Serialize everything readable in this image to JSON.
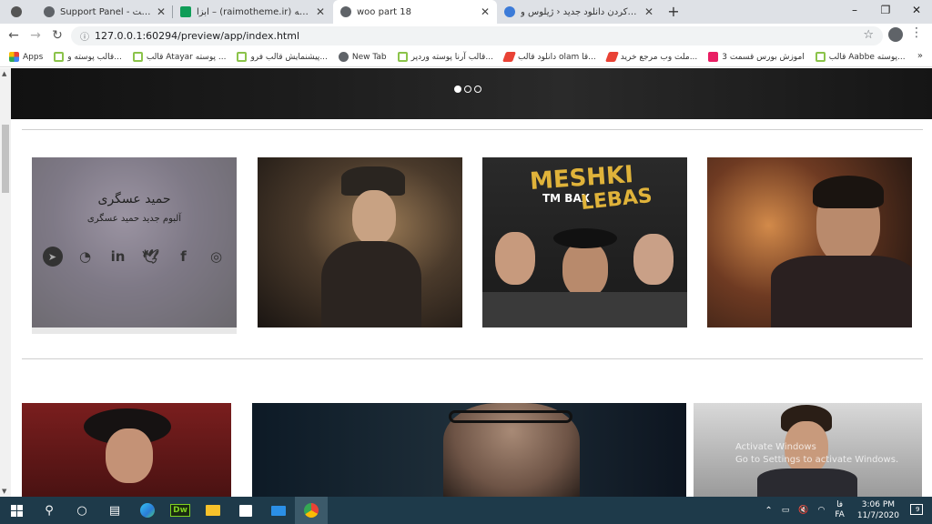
{
  "browser": {
    "tabs": [
      {
        "title": "Support Panel - مشاهده تیکت",
        "favicon": "globe-icon",
        "active": false
      },
      {
        "title": "ابزا – (raimotheme.ir) نمایش دامنه",
        "favicon": "sheet-icon",
        "active": false
      },
      {
        "title": "woo part 18",
        "favicon": "globe-icon",
        "active": true
      },
      {
        "title": "اضافه کردن دانلود جدید ‹ ژیلوس و",
        "favicon": "wp-icon",
        "active": false
      }
    ],
    "new_tab_symbol": "+",
    "window_controls": [
      "–",
      "❐",
      "✕"
    ],
    "address": "127.0.0.1:60294/preview/app/index.html"
  },
  "bookmarks": [
    {
      "label": "Apps",
      "icon": "apps-grid-icon",
      "color": "#e94235"
    },
    {
      "label": "قالب پوسته و...",
      "icon": "r-icon",
      "color": "#8bc34a"
    },
    {
      "label": "قالب Atayar پوسته ...",
      "icon": "r-icon",
      "color": "#8bc34a"
    },
    {
      "label": "پیشنمایش قالب فرو...",
      "icon": "r-icon",
      "color": "#8bc34a"
    },
    {
      "label": "New Tab",
      "icon": "globe-icon",
      "color": "#5f6368"
    },
    {
      "label": "قالب آرنا پوسته وردپر...",
      "icon": "r-icon",
      "color": "#8bc34a"
    },
    {
      "label": "دانلود قالب olam قا...",
      "icon": "zigzag-icon",
      "color": "#e94235"
    },
    {
      "label": "ملت وب مرجع خرید...",
      "icon": "zigzag-icon",
      "color": "#e94235"
    },
    {
      "label": "اموزش بورس قسمت 3",
      "icon": "flower-icon",
      "color": "#e91e63"
    },
    {
      "label": "قالب Aabbe پوسته...",
      "icon": "r-icon",
      "color": "#8bc34a"
    }
  ],
  "bookmarks_more": "»",
  "slider": {
    "dots": [
      true,
      false,
      false
    ]
  },
  "featured_card": {
    "name": "حمید عسگری",
    "subtitle": "آلبوم جدید حمید عسگری",
    "socials": [
      {
        "icon": "telegram-icon",
        "glyph": "➤"
      },
      {
        "icon": "whatsapp-icon",
        "glyph": "◔"
      },
      {
        "icon": "linkedin-icon",
        "glyph": "in"
      },
      {
        "icon": "twitter-icon",
        "glyph": "🕊"
      },
      {
        "icon": "facebook-icon",
        "glyph": "f"
      },
      {
        "icon": "instagram-icon",
        "glyph": "◎"
      }
    ]
  },
  "poster": {
    "line1": "MESHKI",
    "line2": "TM BAX",
    "line3": "LEBAS"
  },
  "watermark": {
    "line1": "Activate Windows",
    "line2": "Go to Settings to activate Windows."
  },
  "taskbar": {
    "apps": [
      "windows-start-icon",
      "search-icon",
      "cortana-icon",
      "task-view-icon",
      "edge-icon",
      "dreamweaver-icon",
      "file-explorer-icon",
      "store-icon",
      "mail-icon",
      "chrome-icon"
    ],
    "dw_label": "Dw",
    "lang": "فا",
    "lang_sub": "FA",
    "time": "3:06 PM",
    "date": "11/7/2020",
    "notification_count": "9"
  }
}
